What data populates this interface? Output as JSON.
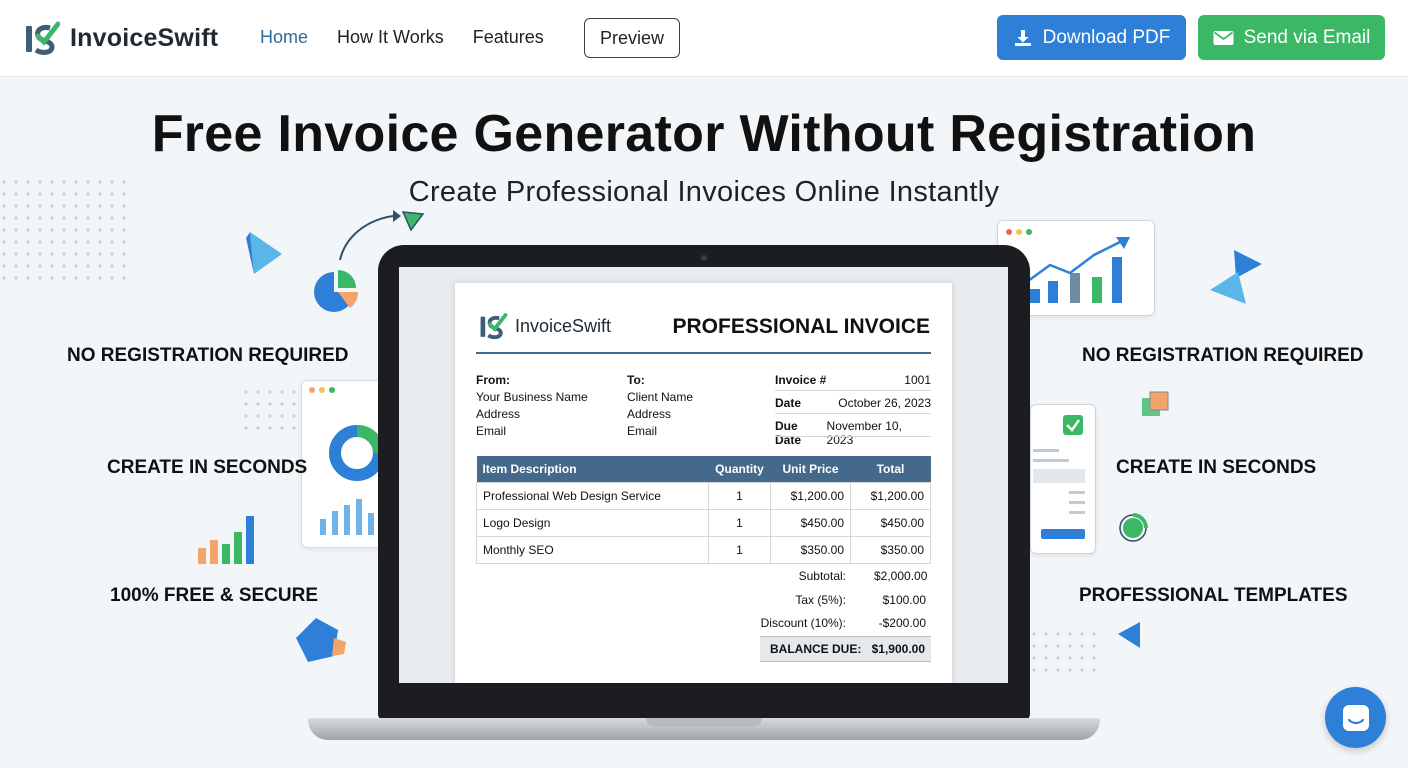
{
  "header": {
    "brand": "InvoiceSwift",
    "nav": [
      {
        "label": "Home",
        "active": true
      },
      {
        "label": "How It Works",
        "active": false
      },
      {
        "label": "Features",
        "active": false
      }
    ],
    "preview_label": "Preview",
    "download_label": "Download PDF",
    "email_label": "Send via Email"
  },
  "hero": {
    "title": "Free Invoice Generator Without Registration",
    "subtitle": "Create Professional Invoices Online Instantly"
  },
  "features": {
    "left": [
      "NO REGISTRATION REQUIRED",
      "CREATE IN SECONDS",
      "100% FREE & SECURE"
    ],
    "right": [
      "NO REGISTRATION REQUIRED",
      "CREATE IN SECONDS",
      "PROFESSIONAL TEMPLATES"
    ]
  },
  "invoice": {
    "brand": "InvoiceSwift",
    "title": "PROFESSIONAL INVOICE",
    "from": {
      "label": "From:",
      "lines": [
        "Your Business Name",
        "Address",
        "Email"
      ]
    },
    "to": {
      "label": "To:",
      "lines": [
        "Client Name",
        "Address",
        "Email"
      ]
    },
    "meta": [
      {
        "label": "Invoice #",
        "value": "1001"
      },
      {
        "label": "Date",
        "value": "October 26, 2023"
      },
      {
        "label": "Due Date",
        "value": "November 10, 2023"
      }
    ],
    "columns": [
      "Item Description",
      "Quantity",
      "Unit Price",
      "Total"
    ],
    "items": [
      {
        "desc": "Professional Web Design Service",
        "qty": "1",
        "price": "$1,200.00",
        "total": "$1,200.00"
      },
      {
        "desc": "Logo Design",
        "qty": "1",
        "price": "$450.00",
        "total": "$450.00"
      },
      {
        "desc": "Monthly SEO",
        "qty": "1",
        "price": "$350.00",
        "total": "$350.00"
      }
    ],
    "totals": [
      {
        "label": "Subtotal:",
        "value": "$2,000.00"
      },
      {
        "label": "Tax (5%):",
        "value": "$100.00"
      },
      {
        "label": "Discount (10%):",
        "value": "-$200.00"
      }
    ],
    "balance": {
      "label": "BALANCE DUE:",
      "value": "$1,900.00"
    }
  },
  "colors": {
    "primary_blue": "#2d7fd8",
    "green": "#3bb866",
    "table_header": "#45698a",
    "nav_active": "#2e6c9a"
  },
  "icons": {
    "download": "download-icon",
    "email": "envelope-icon",
    "chat": "chat-icon"
  }
}
